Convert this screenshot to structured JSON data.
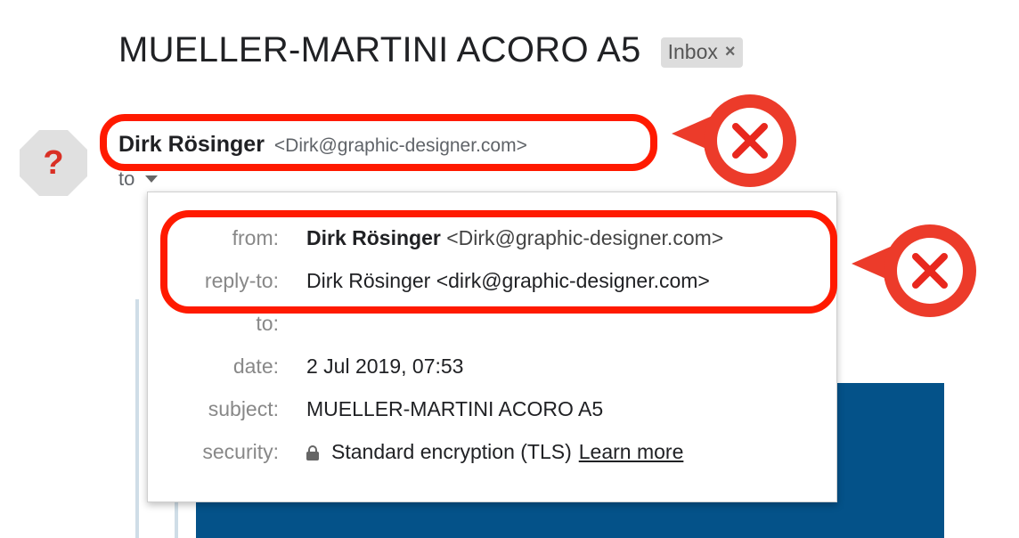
{
  "header": {
    "subject": "MUELLER-MARTINI ACORO A5",
    "label_chip": "Inbox",
    "label_remove": "×"
  },
  "avatar": {
    "glyph": "?"
  },
  "sender": {
    "name": "Dirk Rösinger",
    "email": "<Dirk@graphic-designer.com>"
  },
  "recipient": {
    "to_label": "to"
  },
  "details": {
    "from_label": "from:",
    "from_name": "Dirk Rösinger",
    "from_email": "<Dirk@graphic-designer.com>",
    "replyto_label": "reply-to:",
    "replyto_value": "Dirk Rösinger <dirk@graphic-designer.com>",
    "to_label": "to:",
    "to_value": "",
    "date_label": "date:",
    "date_value": "2 Jul 2019, 07:53",
    "subject_label": "subject:",
    "subject_value": "MUELLER-MARTINI ACORO A5",
    "security_label": "security:",
    "security_value": "Standard encryption (TLS)",
    "learn_more": "Learn more"
  },
  "colors": {
    "highlight": "#ff1a00",
    "body_banner": "#045289",
    "avatar_bg": "#e0e0e0",
    "avatar_fg": "#d93025"
  },
  "icons": [
    "warning-x-icon",
    "lock-icon",
    "chevron-down-icon",
    "question-icon"
  ]
}
